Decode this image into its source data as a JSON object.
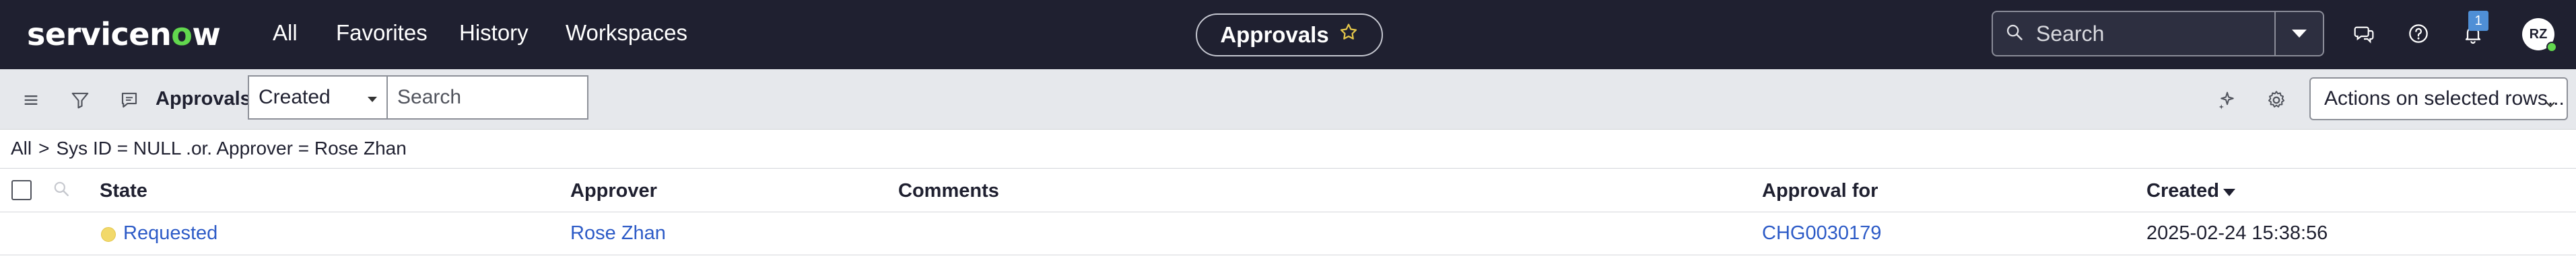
{
  "header": {
    "brand": {
      "before": "servicen",
      "accent": "o",
      "after": "w"
    },
    "nav": [
      "All",
      "Favorites",
      "History",
      "Workspaces"
    ],
    "context_title": "Approvals",
    "search_placeholder": "Search",
    "notification_count": "1",
    "avatar_initials": "RZ"
  },
  "toolbar": {
    "title": "Approvals",
    "field_select": "Created",
    "search_placeholder": "Search",
    "actions_select": "Actions on selected rows..."
  },
  "breadcrumb": {
    "root": "All",
    "separator": ">",
    "filter": "Sys ID = NULL .or. Approver = Rose Zhan"
  },
  "table": {
    "columns": [
      "State",
      "Approver",
      "Comments",
      "Approval for",
      "Created"
    ],
    "sorted_column": "Created",
    "sort_direction": "descending",
    "rows": [
      {
        "state": "Requested",
        "approver": "Rose Zhan",
        "comments": "",
        "approval_for": "CHG0030179",
        "created": "2025-02-24 15:38:56"
      }
    ]
  },
  "colors": {
    "header_bg": "#1f2030",
    "brand_accent": "#62d84e",
    "link": "#2d5bc7",
    "state_requested": "#f2d96a",
    "star": "#e6c84a",
    "badge": "#4f8fd6"
  },
  "icons": {
    "context_pill": "star-icon",
    "search": "search-icon",
    "search_scope": "chevron-down-icon",
    "header_actions": [
      "chat-icon",
      "help-icon",
      "bell-icon"
    ],
    "toolbar_left": [
      "menu-icon",
      "filter-icon",
      "comment-icon"
    ],
    "toolbar_right": [
      "sparkle-icon",
      "gear-icon"
    ],
    "column_search": "search-icon"
  }
}
